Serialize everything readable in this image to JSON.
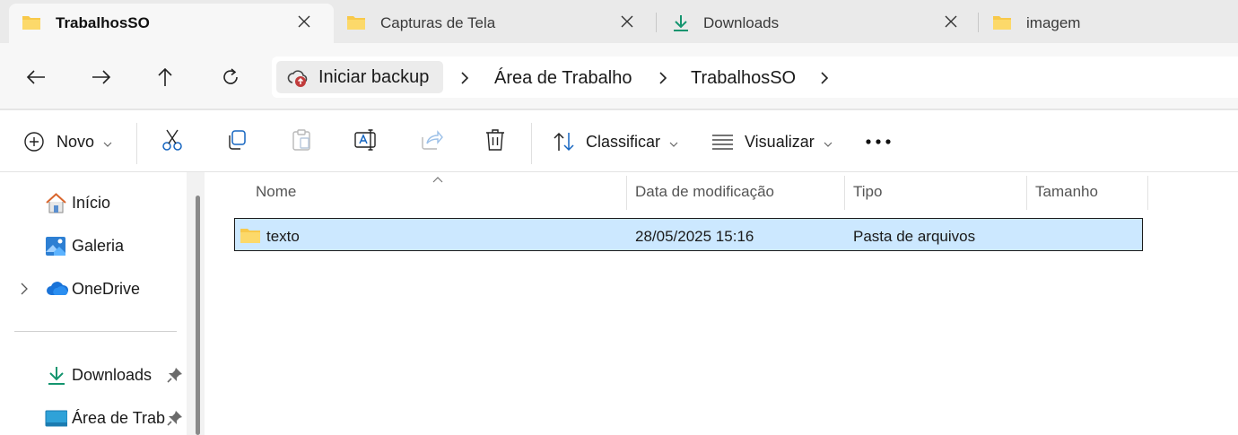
{
  "tabs": [
    {
      "label": "TrabalhosSO",
      "icon": "folder-icon",
      "active": true
    },
    {
      "label": "Capturas de Tela",
      "icon": "folder-icon",
      "active": false
    },
    {
      "label": "Downloads",
      "icon": "download-icon",
      "active": false
    },
    {
      "label": "imagem",
      "icon": "folder-icon",
      "active": false
    }
  ],
  "breadcrumb": {
    "root": "Iniciar backup",
    "items": [
      "Área de Trabalho",
      "TrabalhosSO"
    ]
  },
  "toolbar": {
    "new_label": "Novo",
    "sort_label": "Classificar",
    "view_label": "Visualizar"
  },
  "sidebar": {
    "items": [
      {
        "label": "Início",
        "icon": "home-icon"
      },
      {
        "label": "Galeria",
        "icon": "gallery-icon"
      },
      {
        "label": "OneDrive",
        "icon": "cloud-icon"
      },
      {
        "label": "Downloads",
        "icon": "download-icon",
        "pinned": true
      },
      {
        "label": "Área de Traba",
        "icon": "desktop-icon",
        "pinned": true
      }
    ]
  },
  "table": {
    "columns": [
      "Nome",
      "Data de modificação",
      "Tipo",
      "Tamanho"
    ],
    "rows": [
      {
        "name": "texto",
        "modified": "28/05/2025 15:16",
        "type": "Pasta de arquivos",
        "size": "",
        "selected": true
      }
    ]
  },
  "colors": {
    "selection": "#cce8ff",
    "folder": "#f8c94a",
    "accent": "#0f6cbd",
    "download_green": "#14956f"
  }
}
